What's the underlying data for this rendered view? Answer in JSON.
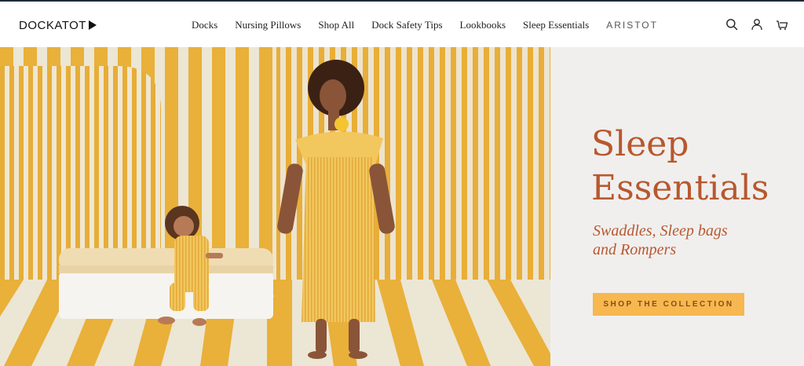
{
  "brand": {
    "logo_text": "DOCKATOT"
  },
  "nav": {
    "items": [
      "Docks",
      "Nursing Pillows",
      "Shop All",
      "Dock Safety Tips",
      "Lookbooks",
      "Sleep Essentials"
    ],
    "partner_brand": "ARISTOT"
  },
  "header_icons": [
    "search-icon",
    "account-icon",
    "cart-icon"
  ],
  "hero": {
    "title_line1": "Sleep",
    "title_line2": "Essentials",
    "subtitle_line1": "Swaddles, Sleep bags",
    "subtitle_line2": "and Rompers",
    "cta_label": "SHOP THE COLLECTION"
  },
  "colors": {
    "accent_orange": "#b8582e",
    "cta_yellow": "#f6b84f",
    "stripe_yellow": "#e9b03a",
    "stripe_cream": "#ece6d4",
    "panel_bg": "#f0efee"
  }
}
